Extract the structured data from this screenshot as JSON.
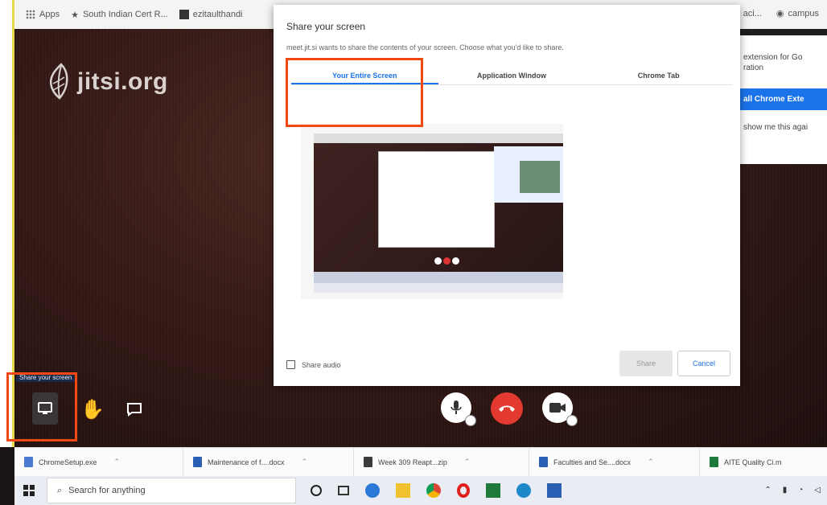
{
  "bookmarks": {
    "items": [
      {
        "label": "Apps",
        "icon": "apps-grid-icon"
      },
      {
        "label": "South Indian Cert R...",
        "icon": "bookmark-icon"
      },
      {
        "label": "ezitaulthandi",
        "icon": "bookmark-icon"
      }
    ],
    "right_items": [
      "aci...",
      "campus"
    ]
  },
  "meeting": {
    "logo_text": "jitsi.org"
  },
  "extension_prompt": {
    "line1": "extension for Go",
    "line2": "ration",
    "button": "all Chrome Exte",
    "show_me": "show me this agai"
  },
  "share_dialog": {
    "title": "Share your screen",
    "subtitle": "meet.jit.si wants to share the contents of your screen. Choose what you'd like to share.",
    "tabs": [
      {
        "label": "Your Entire Screen",
        "active": true
      },
      {
        "label": "Application Window",
        "active": false
      },
      {
        "label": "Chrome Tab",
        "active": false
      }
    ],
    "share_audio_label": "Share audio",
    "share_button": "Share",
    "cancel_button": "Cancel"
  },
  "toolbar": {
    "tooltip": "Share your screen",
    "icons": [
      "screen-share-icon",
      "raise-hand-icon",
      "chat-icon",
      "microphone-icon",
      "hangup-icon",
      "camera-icon"
    ]
  },
  "downloads": [
    {
      "label": "ChromeSetup.exe",
      "color": "#4a7bd0"
    },
    {
      "label": "Maintenance of f....docx",
      "color": "#2b5fb4"
    },
    {
      "label": "Week 309 Reapt...zip",
      "color": "#3b3b3b"
    },
    {
      "label": "Faculties and Se....docx",
      "color": "#2b5fb4"
    },
    {
      "label": "AITE Quality Ci.m",
      "color": "#1d7a3a"
    }
  ],
  "taskbar": {
    "search_placeholder": "Search for anything"
  },
  "colors": {
    "highlight": "#f04a12",
    "accent": "#1a73e8",
    "hangup": "#e23a30"
  }
}
